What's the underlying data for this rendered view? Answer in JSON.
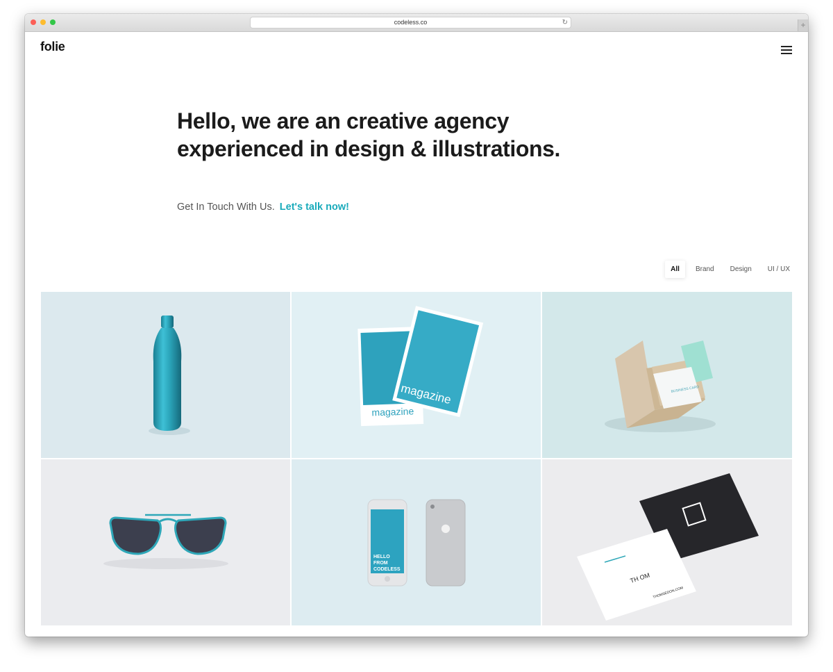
{
  "browser": {
    "url": "codeless.co",
    "reload_icon": "reload-icon",
    "new_tab_icon": "plus-icon"
  },
  "site": {
    "logo": "folie",
    "menu_icon": "hamburger-icon"
  },
  "hero": {
    "title": "Hello, we are an creative agency experienced in design & illustrations.",
    "subtitle": "Get In Touch With Us.",
    "cta": "Let's talk now!"
  },
  "filters": [
    {
      "label": "All",
      "active": true
    },
    {
      "label": "Brand",
      "active": false
    },
    {
      "label": "Design",
      "active": false
    },
    {
      "label": "UI / UX",
      "active": false
    }
  ],
  "portfolio": {
    "items": [
      {
        "subject": "water-bottle",
        "bg": "#dce9ee"
      },
      {
        "subject": "magazine-covers",
        "bg": "#e1f0f4",
        "text": "magazine"
      },
      {
        "subject": "business-card-box",
        "bg": "#d3e8ea",
        "text": "BUSINESS CARD"
      },
      {
        "subject": "sunglasses",
        "bg": "#ebecef"
      },
      {
        "subject": "phones",
        "bg": "#ddecf1",
        "text_lines": [
          "HELLO",
          "FROM",
          "CODELESS"
        ]
      },
      {
        "subject": "business-cards",
        "bg": "#ececee",
        "text": "TH OM",
        "card_text": "THOMSEDON.COM"
      }
    ]
  },
  "colors": {
    "accent": "#1aabbb",
    "teal": "#2fa9c1",
    "heading": "#1b1b1b"
  }
}
